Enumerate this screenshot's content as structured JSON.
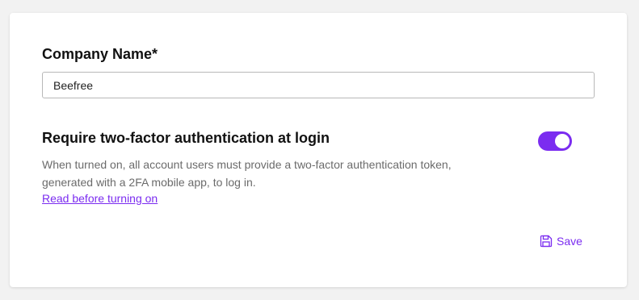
{
  "company": {
    "label": "Company Name*",
    "value": "Beefree"
  },
  "two_factor": {
    "title": "Require two-factor authentication at login",
    "description": "When turned on, all account users must provide a two-factor authentication token, generated with a 2FA mobile app, to log in.",
    "link_label": "Read before turning on",
    "enabled": true
  },
  "actions": {
    "save_label": "Save",
    "save_icon": "save-icon"
  },
  "colors": {
    "accent": "#7b2cf0",
    "background": "#f2f2f2",
    "card": "#ffffff"
  }
}
